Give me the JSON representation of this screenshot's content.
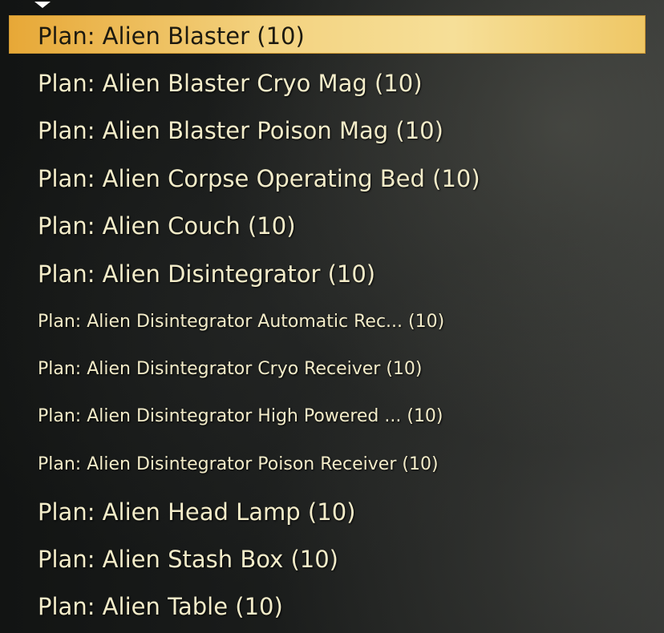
{
  "colors": {
    "highlight": "#f3d27f",
    "text": "#f3ecc9",
    "selected_text": "#1d1a10"
  },
  "scroll_indicator": {
    "icon": "triangle-down-icon"
  },
  "plans": [
    {
      "label": "Plan: Alien Blaster (10)",
      "selected": true
    },
    {
      "label": "Plan: Alien Blaster Cryo Mag (10)"
    },
    {
      "label": "Plan: Alien Blaster Poison Mag (10)"
    },
    {
      "label": "Plan: Alien Corpse Operating Bed (10)"
    },
    {
      "label": "Plan: Alien Couch (10)"
    },
    {
      "label": "Plan: Alien Disintegrator (10)"
    },
    {
      "label": "Plan: Alien Disintegrator Automatic Rec... (10)"
    },
    {
      "label": "Plan: Alien Disintegrator Cryo Receiver (10)"
    },
    {
      "label": "Plan: Alien Disintegrator High Powered ... (10)"
    },
    {
      "label": "Plan: Alien Disintegrator Poison Receiver (10)"
    },
    {
      "label": "Plan: Alien Head Lamp (10)"
    },
    {
      "label": "Plan: Alien Stash Box (10)"
    },
    {
      "label": "Plan: Alien Table (10)"
    }
  ]
}
